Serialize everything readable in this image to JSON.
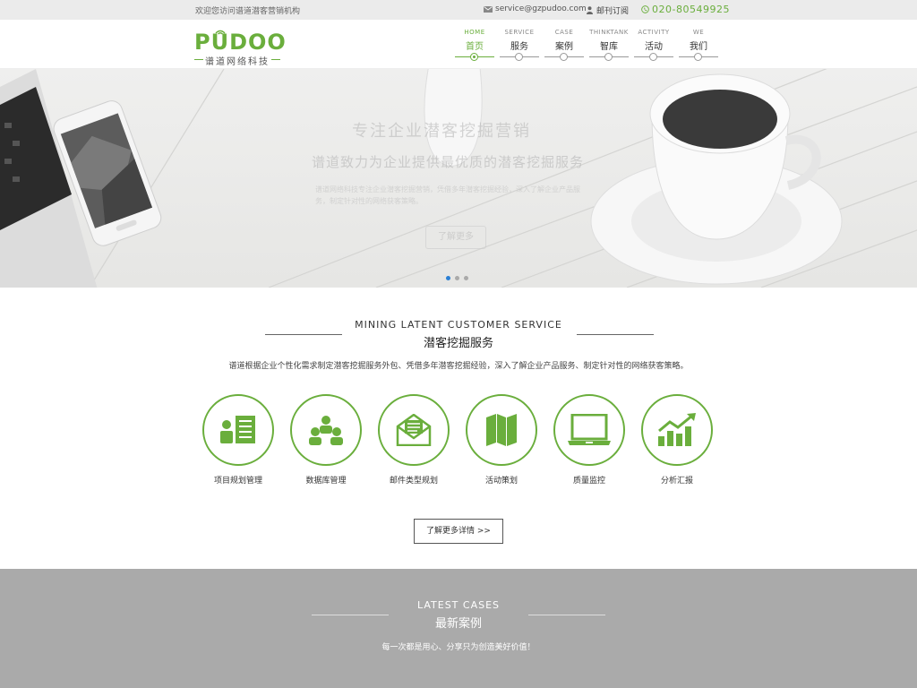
{
  "topbar": {
    "welcome": "欢迎您访问谱道潜客营销机构",
    "email": "service@gzpudoo.com",
    "subscribe": "邮刊订阅",
    "phone": "020-80549925"
  },
  "logo": {
    "word": "PUDOO",
    "sub": "谱道网络科技"
  },
  "nav": [
    {
      "en": "HOME",
      "zh": "首页"
    },
    {
      "en": "SERVICE",
      "zh": "服务"
    },
    {
      "en": "CASE",
      "zh": "案例"
    },
    {
      "en": "THINKTANK",
      "zh": "智库"
    },
    {
      "en": "ACTIVITY",
      "zh": "活动"
    },
    {
      "en": "WE",
      "zh": "我们"
    }
  ],
  "banner": {
    "title": "专注企业潜客挖掘营销",
    "subtitle": "谱道致力为企业提供最优质的潜客挖掘服务",
    "desc": "谱道网络科技专注企业潜客挖掘营销，凭借多年潜客挖掘经验，深入了解企业产品服务，制定针对性的网络获客策略。",
    "button": "了解更多"
  },
  "service": {
    "en": "MINING LATENT CUSTOMER SERVICE",
    "zh": "潜客挖掘服务",
    "desc": "谱道根据企业个性化需求制定潜客挖掘服务外包、凭借多年潜客挖掘经验，深入了解企业产品服务、制定针对性的网络获客策略。",
    "items": [
      {
        "label": "项目规划管理",
        "icon": "project-plan-icon"
      },
      {
        "label": "数据库管理",
        "icon": "database-users-icon"
      },
      {
        "label": "邮件类型规划",
        "icon": "email-envelope-icon"
      },
      {
        "label": "活动策划",
        "icon": "map-fold-icon"
      },
      {
        "label": "质量监控",
        "icon": "monitor-icon"
      },
      {
        "label": "分析汇报",
        "icon": "growth-chart-icon"
      }
    ],
    "more": "了解更多详情 >>"
  },
  "cases": {
    "en": "LATEST CASES",
    "zh": "最新案例",
    "desc": "每一次都是用心、分享只为创造美好价值！"
  },
  "colors": {
    "brand": "#6aae3c",
    "topbar_bg": "#ebebeb",
    "cases_bg": "#aaaaaa",
    "active_dot": "#2a7fd4"
  }
}
